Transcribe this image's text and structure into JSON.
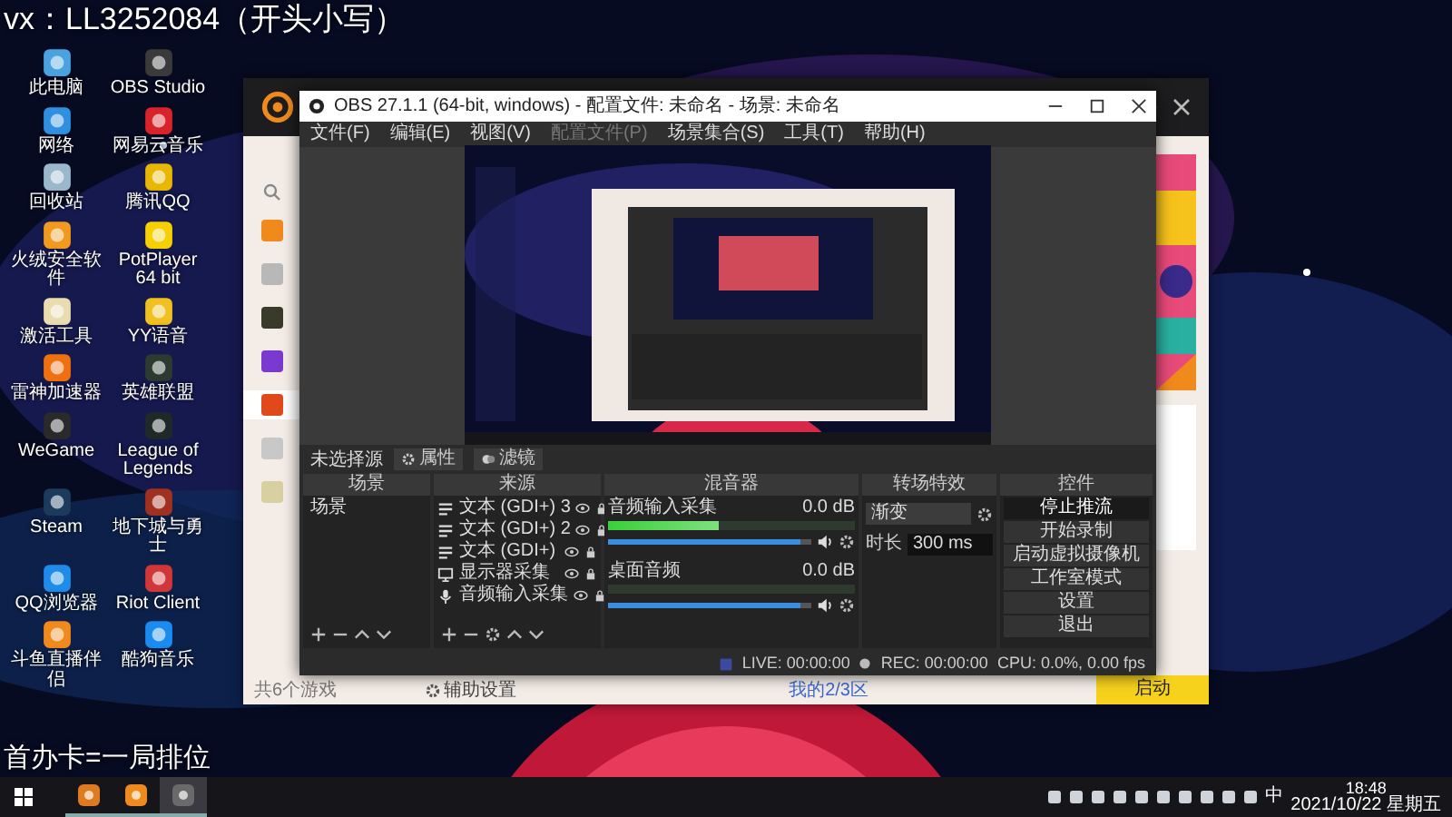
{
  "overlay": {
    "top": "vx：LL3252084（开头小写）",
    "bottom": "首办卡=一局排位"
  },
  "desktop_icons": [
    {
      "label": "此电脑",
      "color": "#4aa3df"
    },
    {
      "label": "OBS Studio",
      "color": "#3a3a3a"
    },
    {
      "label": "网络",
      "color": "#2f8fe0"
    },
    {
      "label": "网易云音乐",
      "color": "#d8232a"
    },
    {
      "label": "回收站",
      "color": "#9ab8cc"
    },
    {
      "label": "腾讯QQ",
      "color": "#e8b800"
    },
    {
      "label": "火绒安全软件",
      "color": "#f29a1f"
    },
    {
      "label": "PotPlayer 64 bit",
      "color": "#f6d000"
    },
    {
      "label": "激活工具",
      "color": "#e8dcb0"
    },
    {
      "label": "YY语音",
      "color": "#f0c020"
    },
    {
      "label": "雷神加速器",
      "color": "#f07010"
    },
    {
      "label": "英雄联盟",
      "color": "#2c3a30"
    },
    {
      "label": "WeGame",
      "color": "#2a2a2a"
    },
    {
      "label": "League of Legends",
      "color": "#1f2a28"
    },
    {
      "label": "Steam",
      "color": "#1b3a5c"
    },
    {
      "label": "地下城与勇士",
      "color": "#a03020"
    },
    {
      "label": "QQ浏览器",
      "color": "#1e8ce8"
    },
    {
      "label": "Riot Client",
      "color": "#d13639"
    },
    {
      "label": "斗鱼直播伴侣",
      "color": "#f08a1c"
    },
    {
      "label": "酷狗音乐",
      "color": "#1a8cf0"
    }
  ],
  "wegame": {
    "sidebar": [
      {
        "color": "#f08a1c",
        "selected": false
      },
      {
        "color": "#b8b8b8",
        "selected": false
      },
      {
        "color": "#3a3a2a",
        "selected": false
      },
      {
        "color": "#7a3ad0",
        "selected": false
      },
      {
        "color": "#e04a1a",
        "selected": true
      },
      {
        "color": "#c8c8c8",
        "selected": false
      },
      {
        "color": "#d8d0a0",
        "selected": false
      }
    ],
    "footer": {
      "count": "共6个游戏",
      "assist": "辅助设置",
      "server": "我的2/3区",
      "launch": "启动"
    }
  },
  "obs": {
    "title": "OBS 27.1.1 (64-bit, windows) - 配置文件: 未命名 - 场景: 未命名",
    "menu": [
      {
        "label": "文件(F)",
        "disabled": false
      },
      {
        "label": "编辑(E)",
        "disabled": false
      },
      {
        "label": "视图(V)",
        "disabled": false
      },
      {
        "label": "配置文件(P)",
        "disabled": true
      },
      {
        "label": "场景集合(S)",
        "disabled": false
      },
      {
        "label": "工具(T)",
        "disabled": false
      },
      {
        "label": "帮助(H)",
        "disabled": false
      }
    ],
    "source_bar": {
      "label": "未选择源",
      "buttons": [
        "属性",
        "滤镜"
      ]
    },
    "scenes": {
      "title": "场景",
      "items": [
        {
          "label": "场景",
          "selected": false
        }
      ]
    },
    "sources": {
      "title": "来源",
      "items": [
        {
          "kind": "text",
          "label": "文本 (GDI+) 3"
        },
        {
          "kind": "text",
          "label": "文本 (GDI+) 2"
        },
        {
          "kind": "text",
          "label": "文本 (GDI+)"
        },
        {
          "kind": "display",
          "label": "显示器采集"
        },
        {
          "kind": "audio",
          "label": "音频输入采集"
        }
      ]
    },
    "mixer": {
      "title": "混音器",
      "channels": [
        {
          "name": "音频输入采集",
          "reading": "0.0 dB",
          "meter": {
            "level": 0.45
          },
          "fader": {
            "level": 0.95
          }
        },
        {
          "name": "桌面音频",
          "reading": "0.0 dB",
          "fader": {
            "level": 0.95
          }
        }
      ]
    },
    "transitions": {
      "title": "转场特效",
      "type": "渐变",
      "duration_label": "时长",
      "duration": "300 ms"
    },
    "controls": {
      "title": "控件",
      "buttons": [
        {
          "label": "停止推流",
          "active": true
        },
        {
          "label": "开始录制",
          "active": false
        },
        {
          "label": "启动虚拟摄像机",
          "active": false
        },
        {
          "label": "工作室模式",
          "active": false
        },
        {
          "label": "设置",
          "active": false
        },
        {
          "label": "退出",
          "active": false
        }
      ]
    },
    "status": {
      "live": "LIVE: 00:00:00",
      "rec": "REC: 00:00:00",
      "cpu": "CPU: 0.0%, 0.00 fps"
    }
  },
  "taskbar": {
    "apps": [
      {
        "color": "#e07a20",
        "selected": false
      },
      {
        "color": "#f08a1c",
        "selected": false
      },
      {
        "color": "#6a6a6a",
        "selected": true
      }
    ],
    "ime": "中",
    "time": "18:48",
    "date": "2021/10/22 星期五"
  }
}
